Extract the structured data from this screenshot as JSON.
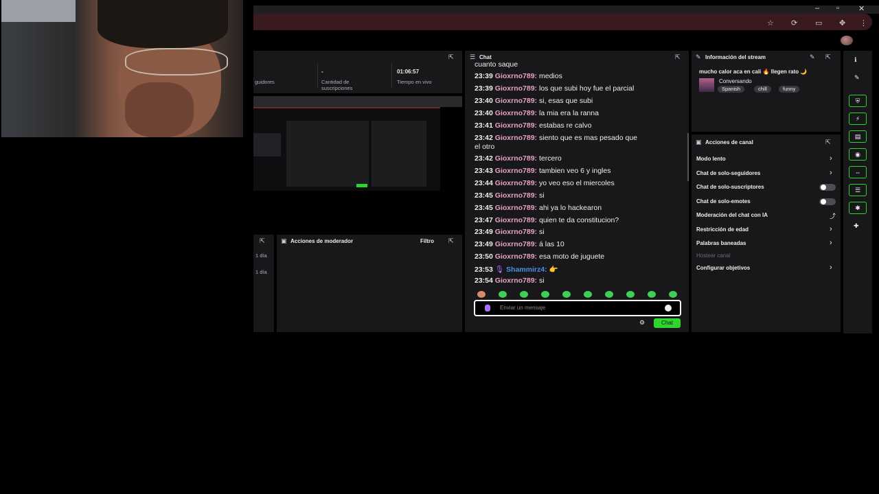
{
  "browser": {
    "window_controls": [
      "–",
      "▫",
      "✕"
    ],
    "bar_icons": [
      "star-icon",
      "extension-icon",
      "sidepanel-icon",
      "puzzle-icon",
      "menu-icon"
    ]
  },
  "stats": {
    "followers_label": "guidores",
    "subs_value": "-",
    "subs_label": "Cantidad de suscripciones",
    "live_time": "01:06:57",
    "live_label": "Tiempo en vivo"
  },
  "mod_actions": {
    "title": "Acciones de moderador",
    "filter": "Filtro",
    "side_entries": [
      "1 día",
      "1 día"
    ]
  },
  "chat": {
    "title": "Chat",
    "partial_top": "cuanto saque",
    "messages": [
      {
        "ts": "23:39",
        "user": "Gioxrno789",
        "text": "medios"
      },
      {
        "ts": "23:39",
        "user": "Gioxrno789",
        "text": "los que subi hoy fue el parcial"
      },
      {
        "ts": "23:40",
        "user": "Gioxrno789",
        "text": "si, esas que subi"
      },
      {
        "ts": "23:40",
        "user": "Gioxrno789",
        "text": "la mia era la ranna"
      },
      {
        "ts": "23:41",
        "user": "Gioxrno789",
        "text": "estabas re calvo"
      },
      {
        "ts": "23:42",
        "user": "Gioxrno789",
        "text": "siento que es mas pesado que"
      },
      {
        "ts": "23:42",
        "user": "Gioxrno789",
        "text": "tercero"
      },
      {
        "ts": "23:43",
        "user": "Gioxrno789",
        "text": "tambien veo 6 y ingles"
      },
      {
        "ts": "23:44",
        "user": "Gioxrno789",
        "text": "yo veo eso el miercoles"
      },
      {
        "ts": "23:45",
        "user": "Gioxrno789",
        "text": "si"
      },
      {
        "ts": "23:45",
        "user": "Gioxrno789",
        "text": "ahi ya lo hackearon"
      },
      {
        "ts": "23:47",
        "user": "Gioxrno789",
        "text": "quien te da constitucion?"
      },
      {
        "ts": "23:49",
        "user": "Gioxrno789",
        "text": "si"
      },
      {
        "ts": "23:49",
        "user": "Gioxrno789",
        "text": "á las 10"
      },
      {
        "ts": "23:50",
        "user": "Gioxrno789",
        "text": "esa moto de juguete"
      },
      {
        "ts": "23:53",
        "user": "Shammirz4",
        "text": ""
      },
      {
        "ts": "23:54",
        "user": "Gioxrno789",
        "text": "si"
      }
    ],
    "wrap_continuation": "el otro",
    "input_placeholder": "Enviar un mensaje",
    "send_label": "Chat"
  },
  "stream_info": {
    "title": "Información del stream",
    "stream_title": "mucho calor aca en cali 🔥 llegen rato 🌙",
    "category": "Conversando",
    "tags": [
      "Spanish",
      "chill",
      "funny"
    ]
  },
  "channel_actions": {
    "title": "Acciones de canal",
    "items": [
      {
        "label": "Modo lento",
        "control": "chevron"
      },
      {
        "label": "Chat de solo-seguidores",
        "control": "chevron"
      },
      {
        "label": "Chat de solo-suscriptores",
        "control": "toggle"
      },
      {
        "label": "Chat de solo-emotes",
        "control": "toggle"
      },
      {
        "label": "Moderación del chat con IA",
        "control": "chart"
      },
      {
        "label": "Restricción de edad",
        "control": "chevron"
      },
      {
        "label": "Palabras baneadas",
        "control": "chevron"
      },
      {
        "label": "Hostear canal",
        "control": "disabled"
      },
      {
        "label": "Configurar objetivos",
        "control": "chevron"
      }
    ]
  },
  "colors": {
    "accent_green": "#2ed52f",
    "username_pink": "#e6a3c4",
    "username_blue": "#4a90e2",
    "panel_bg": "#18181b"
  }
}
